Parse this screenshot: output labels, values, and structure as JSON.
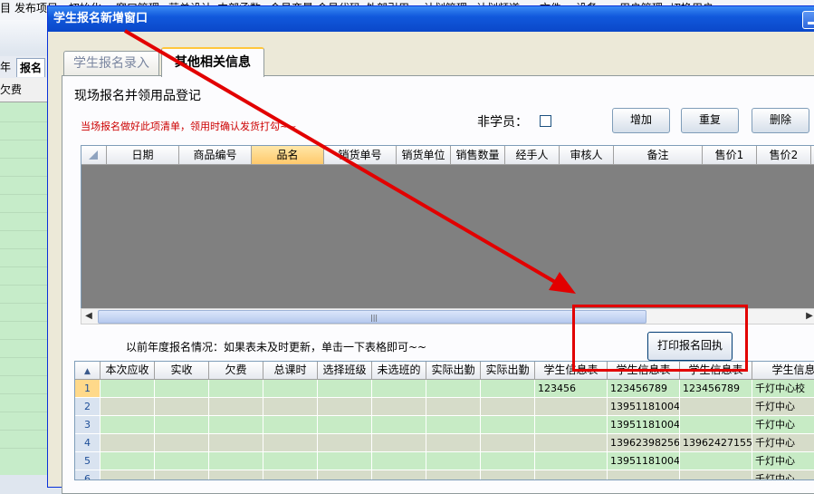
{
  "background_app": {
    "menu": [
      "目",
      "发布项目",
      "初始化",
      "窗口管理",
      "营单设计",
      "内部函数",
      "会员变量",
      "会员代码",
      "外部引用",
      "计划管理",
      "计划频道",
      "文件",
      "设备",
      "用户管理",
      "切换用户"
    ],
    "tabs": [
      "年",
      "报名"
    ],
    "grid_header": "欠费"
  },
  "window": {
    "title": "学生报名新增窗口"
  },
  "tabs": [
    {
      "label": "学生报名录入"
    },
    {
      "label": "其他相关信息"
    }
  ],
  "section": {
    "title": "现场报名并领用品登记",
    "note": "当场报名做好此项清单，领用时确认发货打勾~~",
    "nonmember_label": "非学员：",
    "buttons": {
      "add": "增加",
      "repeat": "重复",
      "delete": "删除"
    }
  },
  "upper_grid": {
    "columns": [
      "日期",
      "商品编号",
      "品名",
      "销货单号",
      "销货单位",
      "销售数量",
      "经手人",
      "审核人",
      "备注",
      "售价1",
      "售价2"
    ],
    "selected_column": "品名"
  },
  "history": {
    "label": "以前年度报名情况：如果表未及时更新，单击一下表格即可~~",
    "print_button": "打印报名回执"
  },
  "lower_grid": {
    "columns": [
      "本次应收",
      "实收",
      "欠费",
      "总课时",
      "选择班级",
      "未选班的",
      "实际出勤",
      "实际出勤",
      "学生信息表",
      "学生信息表",
      "学生信息表",
      "学生信息"
    ],
    "rows": [
      {
        "num": "1",
        "cells": [
          "",
          "",
          "",
          "",
          "",
          "",
          "",
          "",
          "123456",
          "123456789",
          "123456789",
          "千灯中心校"
        ]
      },
      {
        "num": "2",
        "cells": [
          "",
          "",
          "",
          "",
          "",
          "",
          "",
          "",
          "",
          "13951181004",
          "",
          "千灯中心"
        ]
      },
      {
        "num": "3",
        "cells": [
          "",
          "",
          "",
          "",
          "",
          "",
          "",
          "",
          "",
          "13951181004",
          "",
          "千灯中心"
        ]
      },
      {
        "num": "4",
        "cells": [
          "",
          "",
          "",
          "",
          "",
          "",
          "",
          "",
          "",
          "13962398256",
          "13962427155",
          "千灯中心"
        ]
      },
      {
        "num": "5",
        "cells": [
          "",
          "",
          "",
          "",
          "",
          "",
          "",
          "",
          "",
          "13951181004",
          "",
          "千灯中心"
        ]
      },
      {
        "num": "6",
        "cells": [
          "",
          "",
          "",
          "",
          "",
          "",
          "",
          "",
          "",
          "",
          "",
          "千灯中心"
        ]
      }
    ]
  },
  "colors": {
    "title_blue": "#0a47c9",
    "note_red": "#cc0000",
    "annotation_red": "#e20000",
    "row_green": "#c7ebc5",
    "row_tan": "#d6dcc9",
    "grid_empty": "#808080"
  }
}
